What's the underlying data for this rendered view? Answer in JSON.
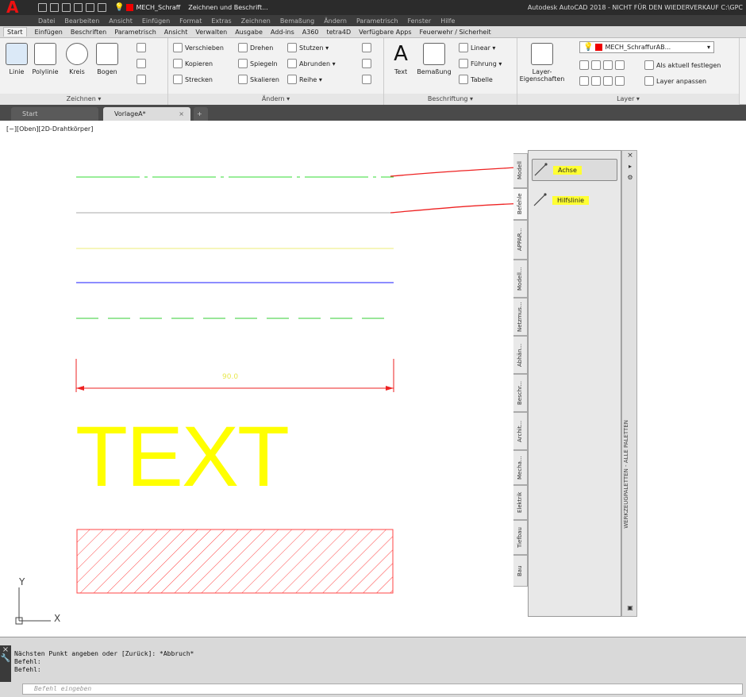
{
  "title": {
    "logo": "A",
    "layer_name": "MECH_Schraff",
    "workspace": "Zeichnen und Beschrift...",
    "window_title": "Autodesk AutoCAD 2018 - NICHT FÜR DEN WIEDERVERKAUF   C:\\GPC"
  },
  "menubar": [
    "Datei",
    "Bearbeiten",
    "Ansicht",
    "Einfügen",
    "Format",
    "Extras",
    "Zeichnen",
    "Bemaßung",
    "Ändern",
    "Parametrisch",
    "Fenster",
    "Hilfe"
  ],
  "ribbon_tabs": [
    "Start",
    "Einfügen",
    "Beschriften",
    "Parametrisch",
    "Ansicht",
    "Verwalten",
    "Ausgabe",
    "Add-ins",
    "A360",
    "tetra4D",
    "Verfügbare Apps",
    "Feuerwehr / Sicherheit"
  ],
  "ribbon": {
    "draw": {
      "label": "Zeichnen ▾",
      "linie": "Linie",
      "polylinie": "Polylinie",
      "kreis": "Kreis",
      "bogen": "Bogen"
    },
    "modify": {
      "label": "Ändern ▾",
      "verschieben": "Verschieben",
      "drehen": "Drehen",
      "stutzen": "Stutzen ▾",
      "kopieren": "Kopieren",
      "spiegeln": "Spiegeln",
      "abrunden": "Abrunden ▾",
      "strecken": "Strecken",
      "skalieren": "Skalieren",
      "reihe": "Reihe ▾"
    },
    "annot": {
      "label": "Beschriftung ▾",
      "text": "Text",
      "bemassung": "Bemaßung",
      "linear": "Linear ▾",
      "fuehrung": "Führung ▾",
      "tabelle": "Tabelle"
    },
    "layer": {
      "label": "Layer ▾",
      "eigenschaften": "Layer-\nEigenschaften",
      "current": "MECH_SchraffurAB...",
      "aktuell": "Als aktuell festlegen",
      "anpassen": "Layer anpassen"
    }
  },
  "doctabs": {
    "start": "Start",
    "active": "VorlageA*"
  },
  "viewport_label": "[−][Oben][2D-Drahtkörper]",
  "drawing": {
    "dimension": "90.0",
    "text": "TEXT"
  },
  "palette": {
    "tabs": [
      "Modell",
      "Befehle",
      "APPAR...",
      "Modell...",
      "Netzmus...",
      "Abhän...",
      "Beschr...",
      "Archit...",
      "Mecha...",
      "Elektrik",
      "Tiefbau",
      "Bau"
    ],
    "tools": [
      "Achse",
      "Hilfslinie"
    ],
    "title": "WERKZEUGPALETTEN - ALLE PALETTEN"
  },
  "ucs": {
    "x": "X",
    "y": "Y"
  },
  "command": {
    "history": [
      "Nächsten Punkt angeben oder [Zurück]: *Abbruch*",
      "Befehl:",
      "Befehl:"
    ],
    "placeholder": "Befehl eingeben"
  },
  "colors": {
    "accent": "#e00000",
    "highlight": "#ffff33",
    "text_yellow": "#ffff00"
  }
}
